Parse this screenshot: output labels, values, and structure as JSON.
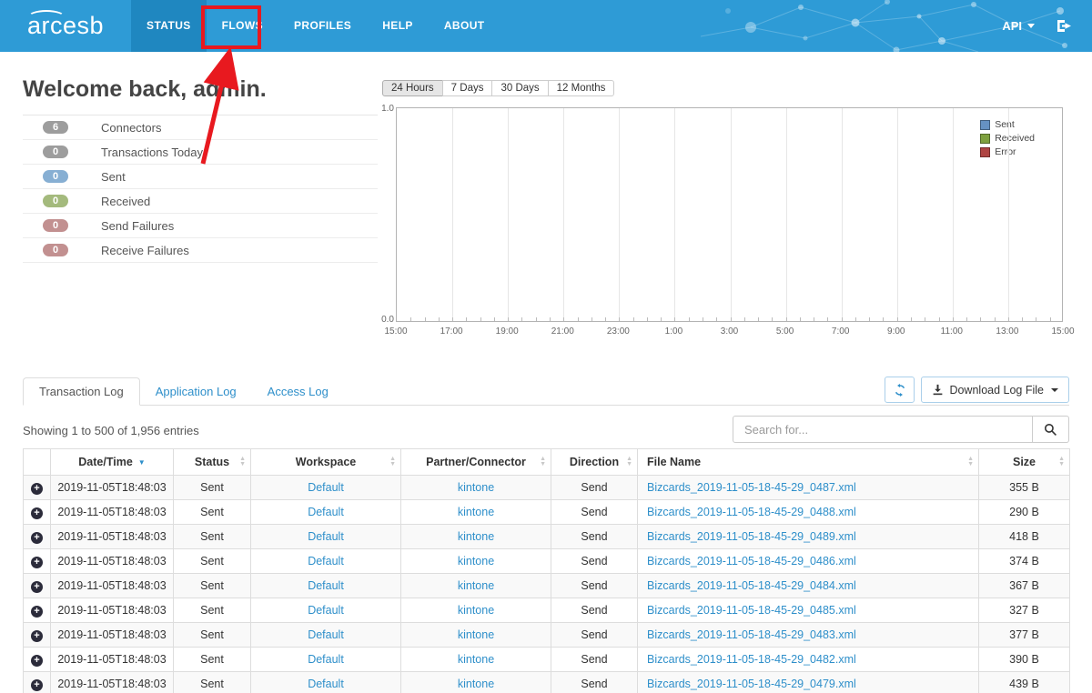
{
  "navbar": {
    "logo": "arcesb",
    "items": [
      {
        "label": "STATUS",
        "active": true
      },
      {
        "label": "FLOWS",
        "active": false
      },
      {
        "label": "PROFILES",
        "active": false
      },
      {
        "label": "HELP",
        "active": false
      },
      {
        "label": "ABOUT",
        "active": false
      }
    ],
    "api_label": "API",
    "background_color": "#2E9BD6",
    "active_item_color": "#1F87C0"
  },
  "annotation": {
    "type": "red-box-and-arrow",
    "target": "FLOWS",
    "color": "#E8191F"
  },
  "welcome": {
    "title": "Welcome back, admin.",
    "stats": [
      {
        "value": "6",
        "label": "Connectors",
        "color": "#9D9D9D"
      },
      {
        "value": "0",
        "label": "Transactions Today",
        "color": "#9D9D9D"
      },
      {
        "value": "0",
        "label": "Sent",
        "color": "#87AFD3"
      },
      {
        "value": "0",
        "label": "Received",
        "color": "#A4BA7D"
      },
      {
        "value": "0",
        "label": "Send Failures",
        "color": "#C29090"
      },
      {
        "value": "0",
        "label": "Receive Failures",
        "color": "#C29090"
      }
    ]
  },
  "chart": {
    "range_buttons": [
      {
        "label": "24 Hours",
        "active": true
      },
      {
        "label": "7 Days",
        "active": false
      },
      {
        "label": "30 Days",
        "active": false
      },
      {
        "label": "12 Months",
        "active": false
      }
    ],
    "chart_data": {
      "type": "line",
      "title": "",
      "xlabel": "",
      "ylabel": "",
      "ylim": [
        0.0,
        1.0
      ],
      "y_tick_labels": [
        "0.0",
        "1.0"
      ],
      "x_ticks": [
        "15:00",
        "17:00",
        "19:00",
        "21:00",
        "23:00",
        "1:00",
        "3:00",
        "5:00",
        "7:00",
        "9:00",
        "11:00",
        "13:00",
        "15:00"
      ],
      "grid": true,
      "legend_position": "top-right",
      "series": [
        {
          "name": "Sent",
          "color": "#6691C3",
          "values": []
        },
        {
          "name": "Received",
          "color": "#7EA03E",
          "values": []
        },
        {
          "name": "Error",
          "color": "#AF4442",
          "values": []
        }
      ]
    }
  },
  "log_section": {
    "tabs": [
      {
        "label": "Transaction Log",
        "active": true
      },
      {
        "label": "Application Log",
        "active": false
      },
      {
        "label": "Access Log",
        "active": false
      }
    ],
    "download_button_label": "Download Log File",
    "showing_text": "Showing 1 to 500 of 1,956 entries",
    "search": {
      "placeholder": "Search for..."
    },
    "table": {
      "columns": [
        "",
        "Date/Time",
        "Status",
        "Workspace",
        "Partner/Connector",
        "Direction",
        "File Name",
        "Size"
      ],
      "sorted_column": "Date/Time",
      "sort_direction": "desc",
      "rows": [
        {
          "date": "2019-11-05T18:48:03",
          "status": "Sent",
          "workspace": "Default",
          "partner": "kintone",
          "direction": "Send",
          "file": "Bizcards_2019-11-05-18-45-29_0487.xml",
          "size": "355 B"
        },
        {
          "date": "2019-11-05T18:48:03",
          "status": "Sent",
          "workspace": "Default",
          "partner": "kintone",
          "direction": "Send",
          "file": "Bizcards_2019-11-05-18-45-29_0488.xml",
          "size": "290 B"
        },
        {
          "date": "2019-11-05T18:48:03",
          "status": "Sent",
          "workspace": "Default",
          "partner": "kintone",
          "direction": "Send",
          "file": "Bizcards_2019-11-05-18-45-29_0489.xml",
          "size": "418 B"
        },
        {
          "date": "2019-11-05T18:48:03",
          "status": "Sent",
          "workspace": "Default",
          "partner": "kintone",
          "direction": "Send",
          "file": "Bizcards_2019-11-05-18-45-29_0486.xml",
          "size": "374 B"
        },
        {
          "date": "2019-11-05T18:48:03",
          "status": "Sent",
          "workspace": "Default",
          "partner": "kintone",
          "direction": "Send",
          "file": "Bizcards_2019-11-05-18-45-29_0484.xml",
          "size": "367 B"
        },
        {
          "date": "2019-11-05T18:48:03",
          "status": "Sent",
          "workspace": "Default",
          "partner": "kintone",
          "direction": "Send",
          "file": "Bizcards_2019-11-05-18-45-29_0485.xml",
          "size": "327 B"
        },
        {
          "date": "2019-11-05T18:48:03",
          "status": "Sent",
          "workspace": "Default",
          "partner": "kintone",
          "direction": "Send",
          "file": "Bizcards_2019-11-05-18-45-29_0483.xml",
          "size": "377 B"
        },
        {
          "date": "2019-11-05T18:48:03",
          "status": "Sent",
          "workspace": "Default",
          "partner": "kintone",
          "direction": "Send",
          "file": "Bizcards_2019-11-05-18-45-29_0482.xml",
          "size": "390 B"
        },
        {
          "date": "2019-11-05T18:48:03",
          "status": "Sent",
          "workspace": "Default",
          "partner": "kintone",
          "direction": "Send",
          "file": "Bizcards_2019-11-05-18-45-29_0479.xml",
          "size": "439 B"
        }
      ]
    }
  }
}
